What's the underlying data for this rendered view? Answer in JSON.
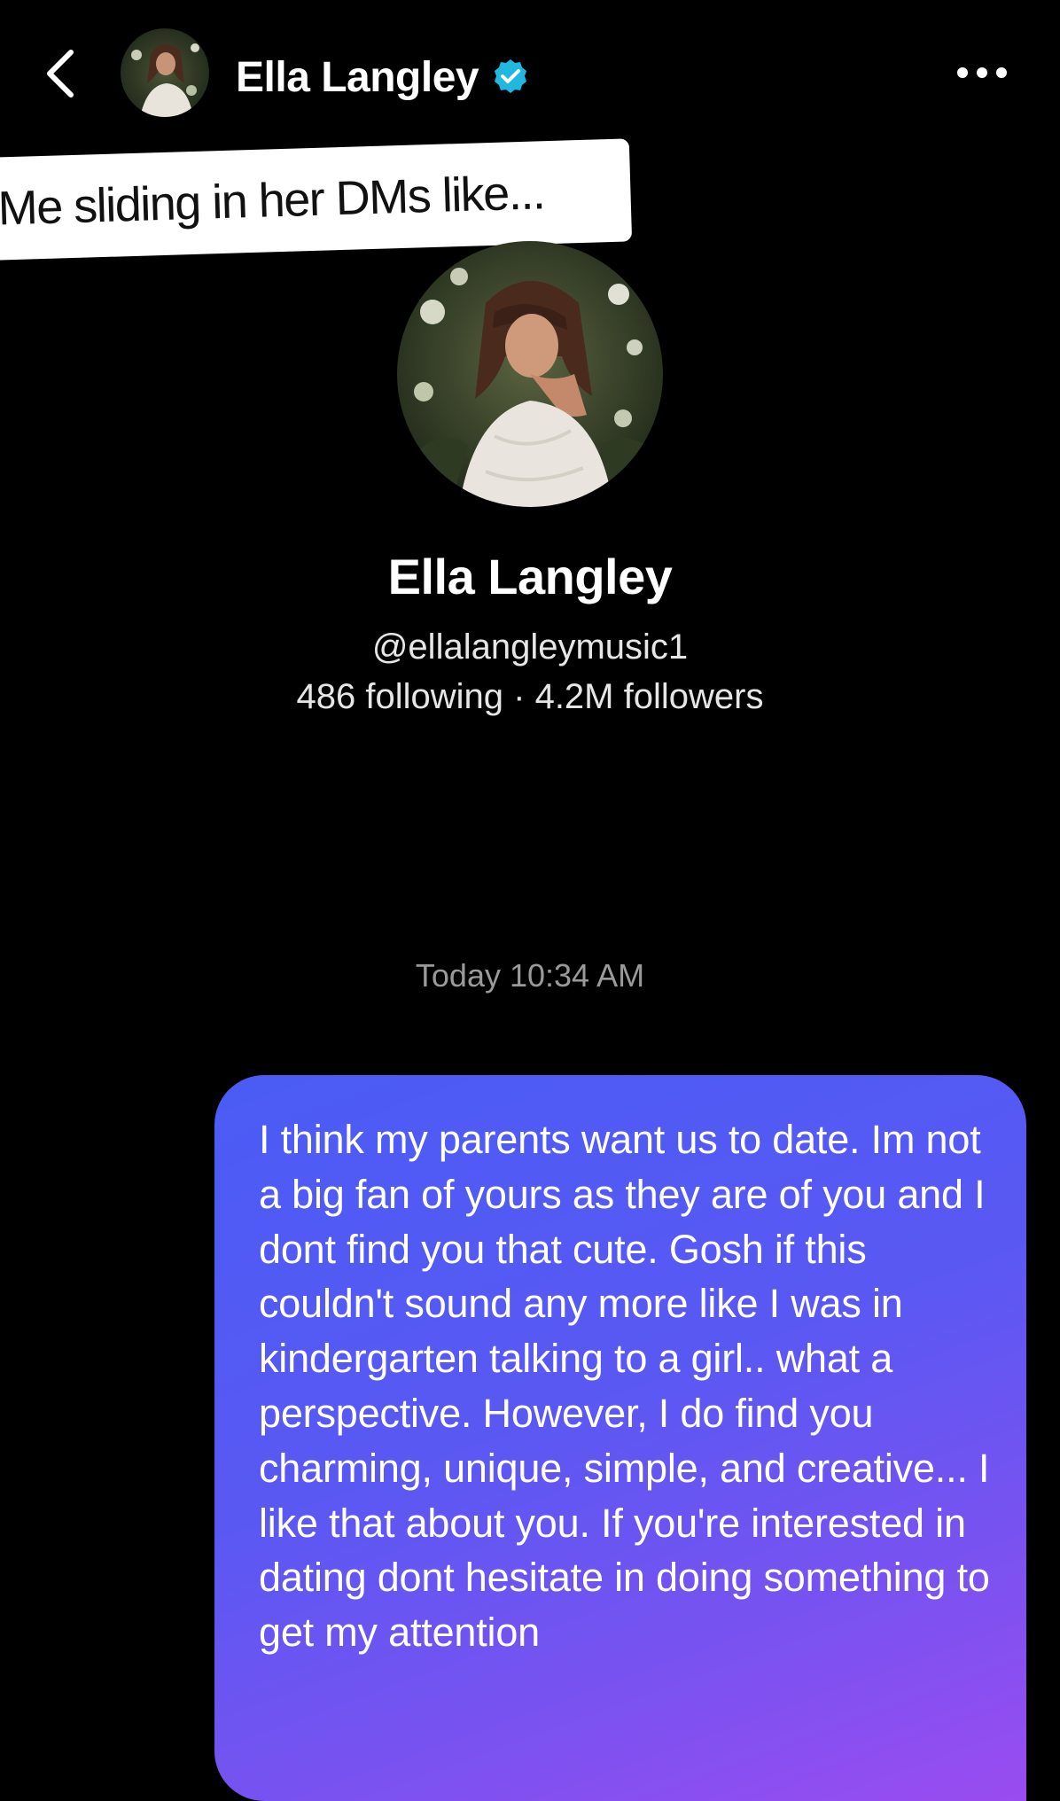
{
  "header": {
    "back_icon": "chevron-left-icon",
    "name": "Ella Langley",
    "verified_icon": "verified-check-icon",
    "verified_color": "#20b8e0",
    "more_icon": "more-horizontal-icon"
  },
  "caption": {
    "text": "Me sliding in her DMs like..."
  },
  "profile": {
    "name": "Ella Langley",
    "handle": "@ellalangleymusic1",
    "stats": "486 following · 4.2M followers"
  },
  "chat": {
    "timestamp": "Today 10:34 AM",
    "messages": [
      {
        "direction": "outgoing",
        "text": "I think my parents want us to date. Im not a big fan of yours as they are of you and I dont find you that cute. Gosh if this couldn't sound any more like I was in kindergarten talking to a girl.. what a perspective. However, I do find you charming, unique, simple, and creative... I like that about you. If you're interested in dating dont hesitate in doing something to get my attention"
      }
    ]
  },
  "colors": {
    "background": "#000000",
    "bubble_start": "#4a5cf5",
    "bubble_end": "#9a4cf0",
    "timestamp": "#9a9a9a"
  }
}
